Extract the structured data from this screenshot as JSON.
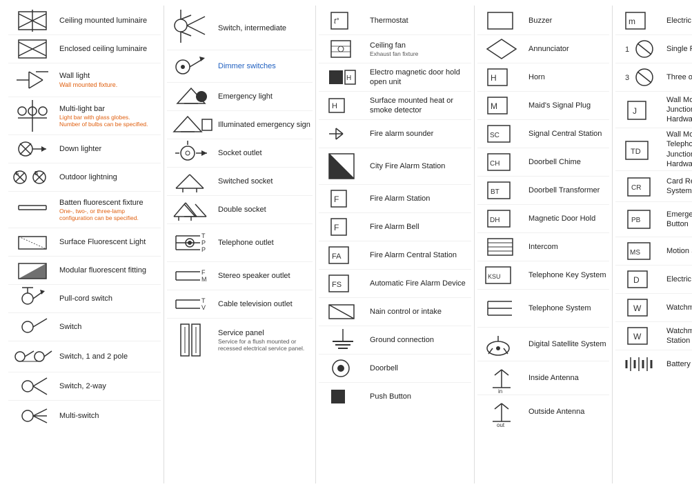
{
  "columns": [
    {
      "id": "col1",
      "items": [
        {
          "id": "ceiling-luminaire",
          "label": "Ceiling mounted luminaire",
          "sub": "",
          "symbol": "x-circle"
        },
        {
          "id": "enclosed-ceiling",
          "label": "Enclosed ceiling luminaire",
          "sub": "",
          "symbol": "x-box"
        },
        {
          "id": "wall-light",
          "label": "Wall light",
          "sub": "Wall mounted fixture.",
          "symbol": "wall-light"
        },
        {
          "id": "multi-light-bar",
          "label": "Multi-light bar",
          "sub": "Light bar with glass globes.\nNumber of bulbs can be specified.",
          "symbol": "multi-light-bar"
        },
        {
          "id": "down-lighter",
          "label": "Down lighter",
          "sub": "",
          "symbol": "down-lighter"
        },
        {
          "id": "outdoor-lighting",
          "label": "Outdoor lightning",
          "sub": "",
          "symbol": "outdoor"
        },
        {
          "id": "batten-fluorescent",
          "label": "Batten fluorescent fixture",
          "sub": "One-, two-, or three-lamp\nconfiguration can be specified.",
          "symbol": "batten"
        },
        {
          "id": "surface-fluorescent",
          "label": "Surface Fluorescent Light",
          "sub": "",
          "symbol": "surface-fluor"
        },
        {
          "id": "modular-fluorescent",
          "label": "Modular fluorescent fitting",
          "sub": "",
          "symbol": "modular-fluor"
        },
        {
          "id": "pull-cord",
          "label": "Pull-cord switch",
          "sub": "",
          "symbol": "pull-cord"
        },
        {
          "id": "switch",
          "label": "Switch",
          "sub": "",
          "symbol": "switch-single"
        },
        {
          "id": "switch-1-2-pole",
          "label": "Switch, 1 and 2 pole",
          "sub": "",
          "symbol": "switch-1-2"
        },
        {
          "id": "switch-2way",
          "label": "Switch, 2-way",
          "sub": "",
          "symbol": "switch-2way"
        },
        {
          "id": "multi-switch",
          "label": "Multi-switch",
          "sub": "",
          "symbol": "multi-switch"
        }
      ]
    },
    {
      "id": "col2",
      "items": [
        {
          "id": "switch-intermediate",
          "label": "Switch, intermediate",
          "sub": "",
          "symbol": "switch-inter",
          "blue": true
        },
        {
          "id": "dimmer-switches",
          "label": "Dimmer switches",
          "sub": "",
          "symbol": "dimmer",
          "blue": true
        },
        {
          "id": "emergency-light",
          "label": "Emergency light",
          "sub": "",
          "symbol": "emerg-light"
        },
        {
          "id": "illuminated-sign",
          "label": "Illuminated emergency sign",
          "sub": "",
          "symbol": "illum-sign"
        },
        {
          "id": "socket-outlet",
          "label": "Socket outlet",
          "sub": "",
          "symbol": "socket"
        },
        {
          "id": "switched-socket",
          "label": "Switched socket",
          "sub": "",
          "symbol": "switched-socket"
        },
        {
          "id": "double-socket",
          "label": "Double socket",
          "sub": "",
          "symbol": "double-socket"
        },
        {
          "id": "telephone-outlet",
          "label": "Telephone outlet",
          "sub": "",
          "symbol": "tel-outlet"
        },
        {
          "id": "stereo-speaker",
          "label": "Stereo speaker outlet",
          "sub": "",
          "symbol": "stereo-speaker"
        },
        {
          "id": "cable-tv",
          "label": "Cable television outlet",
          "sub": "",
          "symbol": "cable-tv"
        },
        {
          "id": "service-panel",
          "label": "Service panel",
          "sub": "Service for a flush mounted or\nrecessed electrical service panel.",
          "symbol": "service-panel"
        }
      ]
    },
    {
      "id": "col3",
      "items": [
        {
          "id": "thermostat",
          "label": "Thermostat",
          "sub": "",
          "symbol": "thermostat"
        },
        {
          "id": "ceiling-fan",
          "label": "Ceiling fan",
          "sub": "Exhaust fan fixture",
          "symbol": "ceiling-fan"
        },
        {
          "id": "em-door-hold",
          "label": "Electro magnetic door hold open unit",
          "sub": "",
          "symbol": "em-door"
        },
        {
          "id": "surface-heat-smoke",
          "label": "Surface mounted heat or smoke detector",
          "sub": "",
          "symbol": "surface-heat"
        },
        {
          "id": "fire-alarm-sounder",
          "label": "Fire alarm sounder",
          "sub": "",
          "symbol": "fire-sounder"
        },
        {
          "id": "city-fire-alarm",
          "label": "City Fire Alarm Station",
          "sub": "",
          "symbol": "city-fire"
        },
        {
          "id": "fire-alarm-station",
          "label": "Fire Alarm Station",
          "sub": "",
          "symbol": "fire-station-f"
        },
        {
          "id": "fire-alarm-bell",
          "label": "Fire Alarm Bell",
          "sub": "",
          "symbol": "fire-bell-f"
        },
        {
          "id": "fire-alarm-central",
          "label": "Fire Alarm Central Station",
          "sub": "",
          "symbol": "fire-central-fa"
        },
        {
          "id": "auto-fire-alarm",
          "label": "Automatic Fire Alarm Device",
          "sub": "",
          "symbol": "auto-fire-fs"
        },
        {
          "id": "main-control",
          "label": "Nain control or intake",
          "sub": "",
          "symbol": "main-control"
        },
        {
          "id": "ground-connection",
          "label": "Ground connection",
          "sub": "",
          "symbol": "ground"
        },
        {
          "id": "doorbell",
          "label": "Doorbell",
          "sub": "",
          "symbol": "doorbell"
        },
        {
          "id": "push-button",
          "label": "Push Button",
          "sub": "",
          "symbol": "push-btn"
        }
      ]
    },
    {
      "id": "col4",
      "items": [
        {
          "id": "buzzer",
          "label": "Buzzer",
          "sub": "",
          "symbol": "buzzer-box"
        },
        {
          "id": "annunciator",
          "label": "Annunciator",
          "sub": "",
          "symbol": "annunciator"
        },
        {
          "id": "horn",
          "label": "Horn",
          "sub": "",
          "symbol": "horn-h"
        },
        {
          "id": "maids-signal",
          "label": "Maid's Signal Plug",
          "sub": "",
          "symbol": "maids-m"
        },
        {
          "id": "signal-central",
          "label": "Signal Central Station",
          "sub": "",
          "symbol": "signal-sc"
        },
        {
          "id": "doorbell-chime",
          "label": "Doorbell Chime",
          "sub": "",
          "symbol": "chime-ch"
        },
        {
          "id": "doorbell-transformer",
          "label": "Doorbell Transformer",
          "sub": "",
          "symbol": "transformer-bt"
        },
        {
          "id": "magnetic-door-hold",
          "label": "Magnetic Door Hold",
          "sub": "",
          "symbol": "mag-door-dh"
        },
        {
          "id": "intercom",
          "label": "Intercom",
          "sub": "",
          "symbol": "intercom"
        },
        {
          "id": "telephone-key",
          "label": "Telephone Key System",
          "sub": "",
          "symbol": "tel-key-ksu"
        },
        {
          "id": "telephone-system",
          "label": "Telephone System",
          "sub": "",
          "symbol": "tel-sys"
        },
        {
          "id": "digital-satellite",
          "label": "Digital Satellite System",
          "sub": "",
          "symbol": "satellite"
        },
        {
          "id": "inside-antenna",
          "label": "Inside Antenna",
          "sub": "",
          "symbol": "inside-ant"
        },
        {
          "id": "outside-antenna",
          "label": "Outside Antenna",
          "sub": "",
          "symbol": "outside-ant"
        }
      ]
    },
    {
      "id": "col5",
      "items": [
        {
          "id": "electric-motors",
          "label": "Electric Motors",
          "sub": "",
          "symbol": "motor-m"
        },
        {
          "id": "single-phase",
          "label": "Single Phase",
          "sub": "",
          "num": "1",
          "symbol": "single-phase"
        },
        {
          "id": "three-polyphase",
          "label": "Three of Polyphase",
          "sub": "",
          "num": "3",
          "symbol": "three-phase"
        },
        {
          "id": "wall-junction-hw",
          "label": "Wall Mounted Electrical Junction Box for Hardware",
          "sub": "",
          "symbol": "junction-j"
        },
        {
          "id": "wall-telephone-hw",
          "label": "Wall Mounted Telephone/Data Junction Box for Hardware",
          "sub": "",
          "symbol": "junction-td"
        },
        {
          "id": "card-reader",
          "label": "Card Reader Access System",
          "sub": "",
          "symbol": "card-cr"
        },
        {
          "id": "emergency-release",
          "label": "Emergency Release Button",
          "sub": "",
          "symbol": "emerg-pb"
        },
        {
          "id": "motion-sensor",
          "label": "Motion Sensor",
          "sub": "",
          "symbol": "motion-ms"
        },
        {
          "id": "electric-door-opener",
          "label": "Electric Door Opener",
          "sub": "",
          "symbol": "door-opener-d"
        },
        {
          "id": "watchmans-station",
          "label": "Watchman's Station",
          "sub": "",
          "symbol": "watchman-w"
        },
        {
          "id": "watchmans-central",
          "label": "Watchman's Central Station",
          "sub": "",
          "symbol": "watchman-central-w"
        },
        {
          "id": "battery",
          "label": "Battery",
          "sub": "",
          "symbol": "battery"
        }
      ]
    }
  ]
}
